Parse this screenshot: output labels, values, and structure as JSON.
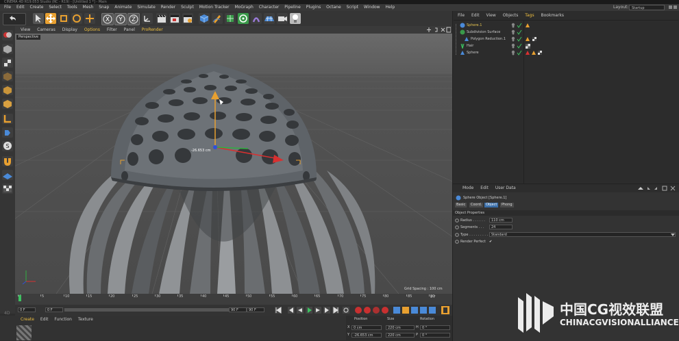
{
  "titlebar": {
    "text": "CINEMA 4D R19.053 Studio (RC - R19) - [Untitled 1 *] - Main"
  },
  "menubar": {
    "items": [
      "File",
      "Edit",
      "Create",
      "Select",
      "Tools",
      "Mesh",
      "Snap",
      "Animate",
      "Simulate",
      "Render",
      "Sculpt",
      "Motion Tracker",
      "MoGraph",
      "Character",
      "Pipeline",
      "Plugins",
      "Octane",
      "Script",
      "Window",
      "Help"
    ]
  },
  "layout": {
    "label": "Layout:",
    "value": "Startup"
  },
  "viewport": {
    "menu": [
      "View",
      "Cameras",
      "Display",
      "Options",
      "Filter",
      "Panel",
      "ProRender"
    ],
    "label": "Perspective",
    "grid_spacing": "Grid Spacing : 100 cm",
    "distance_readout": "-26.653 cm"
  },
  "timeline": {
    "ticks": [
      "0",
      "5",
      "10",
      "15",
      "20",
      "25",
      "30",
      "35",
      "40",
      "45",
      "50",
      "55",
      "60",
      "65",
      "70",
      "75",
      "80",
      "85",
      "90"
    ],
    "frame_end_label": "0 F",
    "start_field": "0 F",
    "min_field": "0 F",
    "max_field": "90 F",
    "end_field": "90 F"
  },
  "material_manager": {
    "menu": [
      "Create",
      "Edit",
      "Function",
      "Texture"
    ]
  },
  "coordinates": {
    "headers": [
      "Position",
      "Size",
      "Rotation"
    ],
    "rows": [
      {
        "axis": "X",
        "position": "0 cm",
        "size": "220 cm",
        "rot_axis": "H",
        "rotation": "0 °"
      },
      {
        "axis": "Y",
        "position": "-26.653 cm",
        "size": "220 cm",
        "rot_axis": "P",
        "rotation": "0 °"
      }
    ]
  },
  "object_manager": {
    "menu": [
      "File",
      "Edit",
      "View",
      "Objects",
      "Tags",
      "Bookmarks"
    ],
    "objects": [
      {
        "name": "Sphere.1",
        "color": "#e8c550"
      },
      {
        "name": "Subdivision Surface",
        "color": "#c8c8c8"
      },
      {
        "name": "Polygon Reduction.1",
        "color": "#c8c8c8"
      },
      {
        "name": "Hair",
        "color": "#c8c8c8"
      },
      {
        "name": "Sphere",
        "color": "#c8c8c8"
      }
    ]
  },
  "attribute_manager": {
    "menu": [
      "Mode",
      "Edit",
      "User Data"
    ],
    "object_title": "Sphere Object [Sphere.1]",
    "tabs": [
      "Basic",
      "Coord.",
      "Object",
      "Phong"
    ],
    "active_tab": "Object",
    "section": "Object Properties",
    "radius_label": "Radius . . . . . .",
    "radius_value": "110 cm",
    "segments_label": "Segments . . .",
    "segments_value": "24",
    "type_label": "Type . . . . . . . . .",
    "type_value": "Standard",
    "render_perfect_label": "Render Perfect",
    "render_perfect_check": "✔"
  },
  "watermark": {
    "line1": "中国CG视效联盟",
    "line2": "CHINACGVISIONALLIANCE"
  },
  "colors": {
    "accent_orange": "#e8a030",
    "menu_highlight": "#f0c040",
    "tag_blue": "#3a6ea8"
  }
}
